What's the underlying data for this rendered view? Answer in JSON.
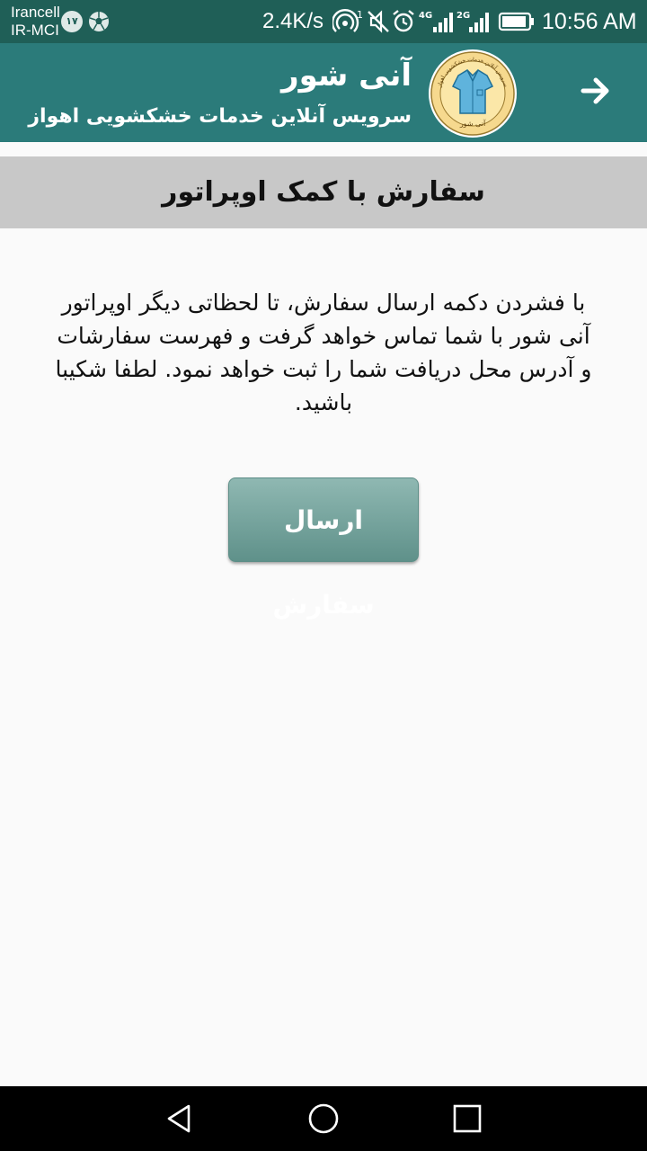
{
  "status_bar": {
    "carrier_1": "Irancell",
    "carrier_2": "IR-MCI",
    "badge": "۱۷",
    "speed": "2.4K/s",
    "network_1": "4G",
    "network_2": "2G",
    "time": "10:56 AM"
  },
  "header": {
    "title": "آنی شور",
    "subtitle": "سرویس آنلاین خدمات خشکشویی اهواز",
    "logo_caption": "آنی شور",
    "logo_ring_text": "سرویس آنلاین خدمات خشکشویی اهواز"
  },
  "main": {
    "heading": "سفارش با کمک اوپراتور",
    "info_text": "با فشردن دکمه ارسال سفارش، تا لحظاتی دیگر اوپراتور آنی شور با شما تماس خواهد گرفت و فهرست سفارشات و آدرس محل دریافت شما را ثبت خواهد نمود. لطفا شکیبا باشید.",
    "submit_label": "ارسال سفارش"
  },
  "colors": {
    "status_bar": "#1f5f57",
    "header": "#2b7b7a",
    "heading_band": "#c8c8c8",
    "button_top": "#8fb8b2",
    "button_bottom": "#5f918a",
    "background": "#fafafa"
  },
  "icons": {
    "back": "arrow-right-icon",
    "logo": "shirt-logo-icon",
    "nav_back": "triangle-back-icon",
    "nav_home": "circle-home-icon",
    "nav_recent": "square-recents-icon"
  }
}
